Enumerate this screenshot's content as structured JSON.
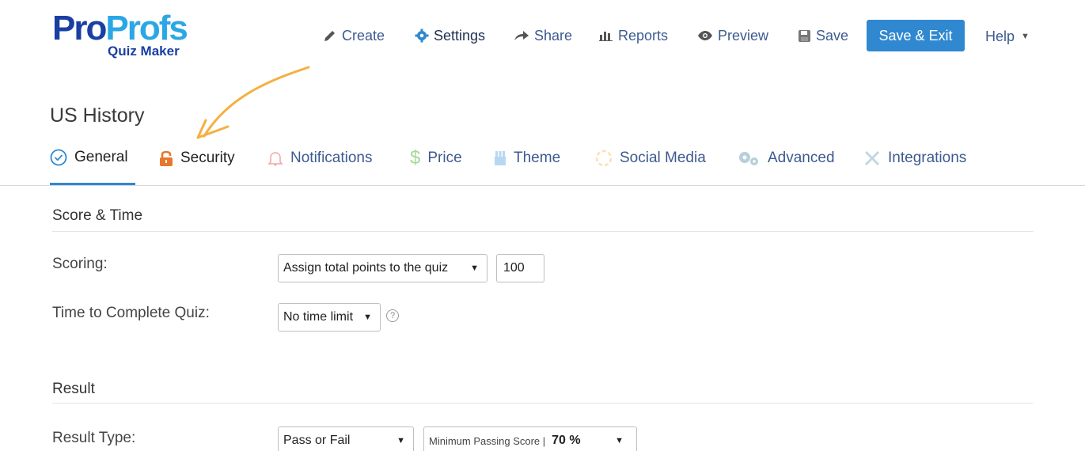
{
  "logo": {
    "part1": "Pro",
    "part2": "Profs",
    "subtitle": "Quiz Maker"
  },
  "topnav": {
    "create": "Create",
    "settings": "Settings",
    "share": "Share",
    "reports": "Reports",
    "preview": "Preview",
    "save": "Save",
    "save_exit": "Save & Exit",
    "help": "Help"
  },
  "quiz": {
    "title": "US History"
  },
  "tabs": [
    {
      "label": "General",
      "icon": "check-circle-icon",
      "active": true
    },
    {
      "label": "Security",
      "icon": "lock-icon"
    },
    {
      "label": "Notifications",
      "icon": "bell-icon"
    },
    {
      "label": "Price",
      "icon": "dollar-icon"
    },
    {
      "label": "Theme",
      "icon": "theme-icon"
    },
    {
      "label": "Social Media",
      "icon": "social-icon"
    },
    {
      "label": "Advanced",
      "icon": "gears-icon"
    },
    {
      "label": "Integrations",
      "icon": "tools-icon"
    }
  ],
  "score_time": {
    "title": "Score & Time",
    "scoring_label": "Scoring:",
    "scoring_value": "Assign total points to the quiz",
    "points_value": "100",
    "time_label": "Time to Complete Quiz:",
    "time_value": "No time limit",
    "help_glyph": "?"
  },
  "result": {
    "title": "Result",
    "type_label": "Result Type:",
    "type_value": "Pass or Fail",
    "min_passing_label": "Minimum Passing Score |",
    "min_passing_value": "70 %"
  },
  "colors": {
    "accent": "#2f88d0",
    "brand_dark": "#1a3fa3",
    "brand_light": "#2aa7e4",
    "annotation": "#f5b041",
    "security_lock": "#e8772e"
  }
}
